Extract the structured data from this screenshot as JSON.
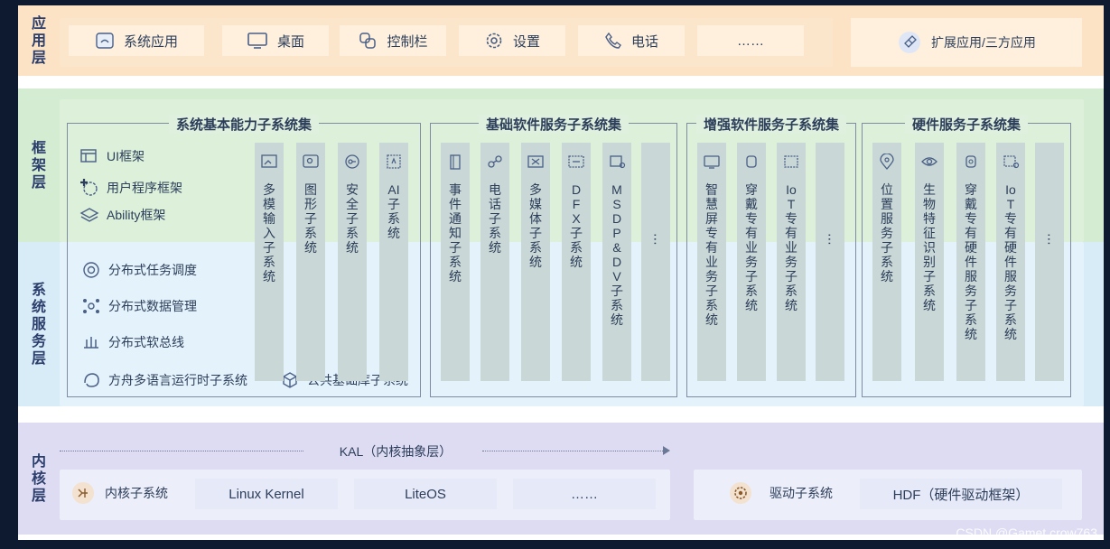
{
  "layers": {
    "app": [
      "应",
      "用",
      "层"
    ],
    "framework": [
      "框",
      "架",
      "层"
    ],
    "service": [
      "系",
      "统",
      "服",
      "务",
      "层"
    ],
    "kernel": [
      "内",
      "核",
      "层"
    ]
  },
  "app_layer": {
    "tiles": [
      {
        "label": "系统应用",
        "icon": "system-app-icon"
      },
      {
        "label": "桌面",
        "icon": "desktop-icon"
      },
      {
        "label": "控制栏",
        "icon": "control-bar-icon"
      },
      {
        "label": "设置",
        "icon": "gear-icon"
      },
      {
        "label": "电话",
        "icon": "phone-icon"
      },
      {
        "label": "……",
        "icon": ""
      }
    ],
    "third_party": "扩展应用/三方应用"
  },
  "framework": {
    "items": [
      "UI框架",
      "用户程序框架",
      "Ability框架"
    ]
  },
  "distributed": {
    "items": [
      "分布式任务调度",
      "分布式数据管理",
      "分布式软总线"
    ],
    "runtime": "方舟多语言运行时子系统",
    "common_lib": "公共基础库子系统"
  },
  "groups": {
    "basic": {
      "title": "系统基本能力子系统集",
      "cols": [
        "多模输入子系统",
        "图形子系统",
        "安全子系统",
        "AI子系统"
      ]
    },
    "software": {
      "title": "基础软件服务子系统集",
      "cols": [
        "事件通知子系统",
        "电话子系统",
        "多媒体子系统",
        "DFX子系统",
        "MSDP&DV子系统",
        "⋯"
      ]
    },
    "enhanced": {
      "title": "增强软件服务子系统集",
      "cols": [
        "智慧屏专有业务子系统",
        "穿戴专有业务子系统",
        "IoT专有业务子系统",
        "⋯"
      ]
    },
    "hardware": {
      "title": "硬件服务子系统集",
      "cols": [
        "位置服务子系统",
        "生物特征识别子系统",
        "穿戴专有硬件服务子系统",
        "IoT专有硬件服务子系统",
        "⋯"
      ]
    }
  },
  "kernel": {
    "kal": "KAL（内核抽象层）",
    "subsystem": "内核子系统",
    "linux": "Linux Kernel",
    "liteos": "LiteOS",
    "more": "……",
    "driver": "驱动子系统",
    "hdf": "HDF（硬件驱动框架）"
  },
  "watermark": "CSDN @Gamet crow763"
}
